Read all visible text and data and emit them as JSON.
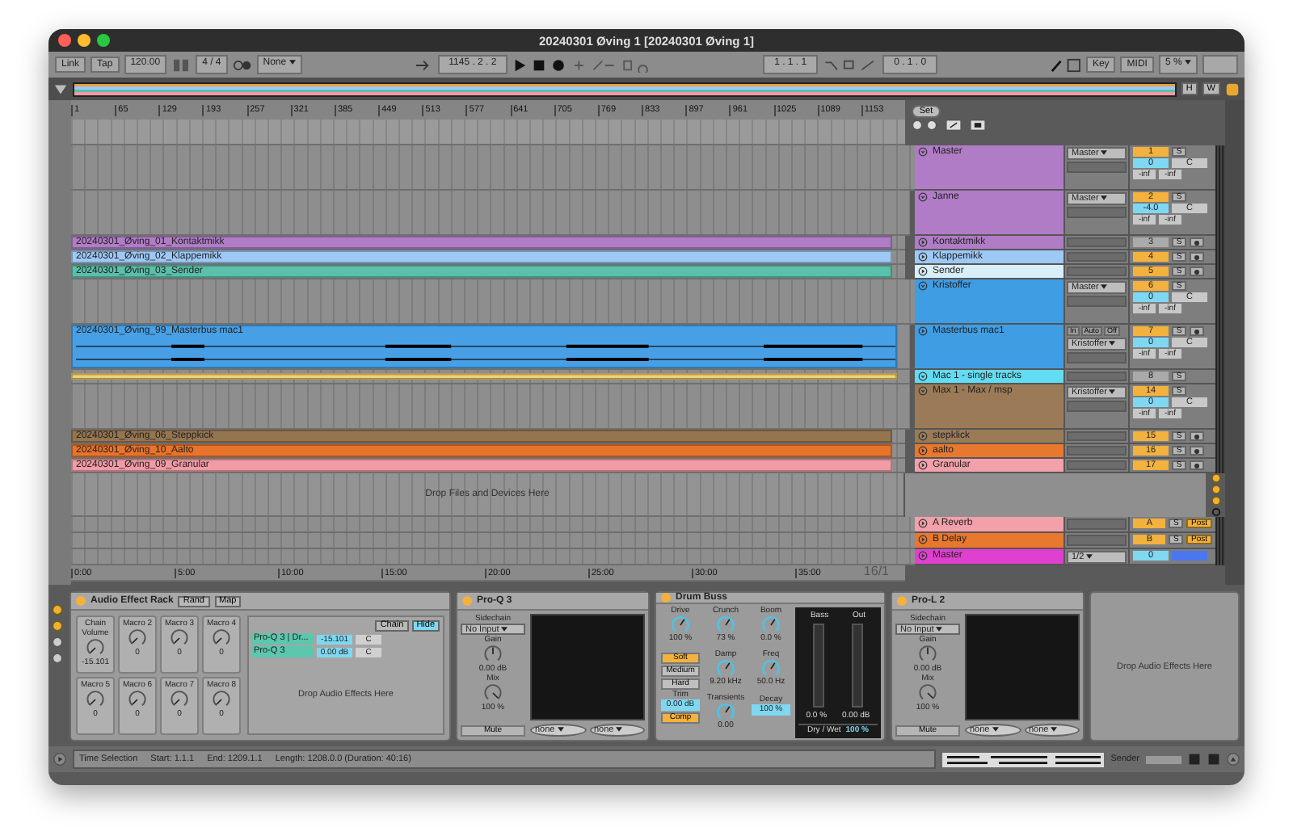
{
  "window": {
    "title": "20240301 Øving 1  [20240301 Øving 1]"
  },
  "toolbar": {
    "link": "Link",
    "tap": "Tap",
    "tempo": "120.00",
    "signature": "4 / 4",
    "quantize": "None",
    "position": "1145 .  2 .  2",
    "loop_start": "1 .  1 .  1",
    "loop_length": "0 .  1 .  0",
    "key": "Key",
    "midi": "MIDI",
    "zoom": "5 %"
  },
  "overview": {
    "buttons": [
      "H",
      "W"
    ]
  },
  "set_button": "Set",
  "ruler": {
    "bars": [
      "1",
      "65",
      "129",
      "193",
      "257",
      "321",
      "385",
      "449",
      "513",
      "577",
      "641",
      "705",
      "769",
      "833",
      "897",
      "961",
      "1025",
      "1089",
      "1153"
    ]
  },
  "tracks": [
    {
      "name": "Master",
      "kind": "group",
      "color": "#b07cc6",
      "expanded": true,
      "active": true,
      "number": "1",
      "solo": "S",
      "output": "Master",
      "volume": "0",
      "pan": "C",
      "peaks": [
        "-inf",
        "-inf"
      ],
      "children": [
        {
          "name": "Janne",
          "kind": "group",
          "color": "#b07cc6",
          "expanded": true,
          "active": true,
          "number": "2",
          "solo": "S",
          "output": "Master",
          "volume": "-4.0",
          "pan": "C",
          "peaks": [
            "-inf",
            "-inf"
          ],
          "children": [
            {
              "name": "Kontaktmikk",
              "kind": "audio",
              "color": "#b07cc6",
              "expanded": false,
              "active": false,
              "number": "3",
              "solo": "S",
              "clip": {
                "name": "20240301_Øving_01_Kontaktmikk",
                "color": "#b07cc6"
              }
            },
            {
              "name": "Klappemikk",
              "kind": "audio",
              "color": "#9ec8f6",
              "expanded": false,
              "active": true,
              "number": "4",
              "solo": "S",
              "clip": {
                "name": "20240301_Øving_02_Klappemikk",
                "color": "#9ec8f6"
              }
            },
            {
              "name": "Sender",
              "kind": "audio",
              "color": "#d8eef8",
              "expanded": false,
              "active": true,
              "number": "5",
              "solo": "S",
              "clip": {
                "name": "20240301_Øving_03_Sender",
                "color": "#5bbfa9"
              }
            }
          ]
        }
      ]
    },
    {
      "name": "Kristoffer",
      "kind": "group",
      "color": "#3f9de3",
      "expanded": true,
      "active": true,
      "number": "6",
      "solo": "S",
      "output": "Master",
      "volume": "0",
      "pan": "C",
      "peaks": [
        "-inf",
        "-inf"
      ],
      "children": [
        {
          "name": "Masterbus mac1",
          "kind": "audio",
          "color": "#3f9de3",
          "expanded": true,
          "active": true,
          "number": "7",
          "solo": "S",
          "monitor": [
            {
              "label": "In",
              "selected": false
            },
            {
              "label": "Auto",
              "selected": false
            },
            {
              "label": "Off",
              "selected": false
            }
          ],
          "output": "Kristoffer",
          "volume": "0",
          "pan": "C",
          "peaks": [
            "-inf",
            "-inf"
          ],
          "clip": {
            "name": "20240301_Øving_99_Masterbus mac1",
            "color": "#47a0e6",
            "waveform": true
          }
        },
        {
          "name": "Mac 1 - single tracks",
          "kind": "group",
          "color": "#62dcf2",
          "expanded": false,
          "active": false,
          "number": "8",
          "solo": "S",
          "clip": {
            "color": "#e8d47c"
          }
        },
        {
          "name": "Max 1 - Max / msp",
          "kind": "group",
          "color": "#9b7b57",
          "expanded": true,
          "active": true,
          "number": "14",
          "solo": "S",
          "output": "Kristoffer",
          "volume": "0",
          "pan": "C",
          "peaks": [
            "-inf",
            "-inf"
          ],
          "children": [
            {
              "name": "stepklick",
              "kind": "audio",
              "color": "#9b7b57",
              "expanded": false,
              "active": true,
              "number": "15",
              "solo": "S",
              "clip": {
                "name": "20240301_Øving_06_Steppkick",
                "color": "#957550"
              }
            },
            {
              "name": "aalto",
              "kind": "audio",
              "color": "#e8782e",
              "expanded": false,
              "active": true,
              "number": "16",
              "solo": "S",
              "clip": {
                "name": "20240301_Øving_10_Aalto",
                "color": "#e8732a"
              }
            },
            {
              "name": "Granular",
              "kind": "audio",
              "color": "#f2a0aa",
              "expanded": false,
              "active": true,
              "number": "17",
              "solo": "S",
              "clip": {
                "name": "20240301_Øving_09_Granular",
                "color": "#f19ba5"
              }
            }
          ]
        }
      ]
    }
  ],
  "drop_hint": "Drop Files and Devices Here",
  "returns": [
    {
      "name": "A Reverb",
      "color": "#f2a0aa",
      "number": "A",
      "solo": "S",
      "send_mode": "Post"
    },
    {
      "name": "B Delay",
      "color": "#e8782e",
      "number": "B",
      "solo": "S",
      "send_mode": "Post"
    }
  ],
  "master": {
    "name": "Master",
    "color": "#e040d0",
    "output": "1/2",
    "volume": "0"
  },
  "time_ruler": {
    "labels": [
      "0:00",
      "5:00",
      "10:00",
      "15:00",
      "20:00",
      "25:00",
      "30:00",
      "35:00"
    ],
    "zoom_label": "16/1"
  },
  "devices": [
    {
      "kind": "rack",
      "title": "Audio Effect Rack",
      "on": true,
      "buttons": [
        "Rand",
        "Map"
      ],
      "macros": [
        {
          "label": "Chain Volume",
          "value": "-15.101"
        },
        {
          "label": "Macro 2",
          "value": "0"
        },
        {
          "label": "Macro 3",
          "value": "0"
        },
        {
          "label": "Macro 4",
          "value": "0"
        },
        {
          "label": "Macro 5",
          "value": "0"
        },
        {
          "label": "Macro 6",
          "value": "0"
        },
        {
          "label": "Macro 7",
          "value": "0"
        },
        {
          "label": "Macro 8",
          "value": "0"
        }
      ],
      "chain_buttons": [
        {
          "label": "Chain",
          "selected": false
        },
        {
          "label": "Hide",
          "selected": true
        }
      ],
      "chains": [
        {
          "name": "Pro-Q 3 | Dr...",
          "volume": "-15.101",
          "pan": "C"
        },
        {
          "name": "Pro-Q 3",
          "volume": "0.00 dB",
          "pan": "C"
        }
      ],
      "drop_hint": "Drop Audio Effects Here"
    },
    {
      "kind": "plugin",
      "title": "Pro-Q 3",
      "on": true,
      "sidechain_label": "Sidechain",
      "sidechain": "No Input",
      "gain_label": "Gain",
      "gain": "0.00 dB",
      "mix_label": "Mix",
      "mix": "100 %",
      "mute": "Mute",
      "menus": [
        "none",
        "none"
      ]
    },
    {
      "kind": "drumbuss",
      "title": "Drum Buss",
      "on": true,
      "columns": [
        [
          {
            "kind": "knob",
            "label": "Drive",
            "value": "100 %"
          },
          {
            "kind": "modes",
            "options": [
              {
                "label": "Soft",
                "selected": true
              },
              {
                "label": "Medium",
                "selected": false
              },
              {
                "label": "Hard",
                "selected": false
              }
            ]
          },
          {
            "kind": "box",
            "label": "Trim",
            "value": "0.00 dB"
          },
          {
            "kind": "toggle",
            "label": "Comp",
            "on": true
          }
        ],
        [
          {
            "kind": "knob",
            "label": "Crunch",
            "value": "73 %"
          },
          {
            "kind": "knob",
            "label": "Damp",
            "value": "9.20 kHz"
          },
          {
            "kind": "knob",
            "label": "Transients",
            "value": "0.00"
          }
        ],
        [
          {
            "kind": "knob",
            "label": "Boom",
            "value": "0.0 %"
          },
          {
            "kind": "knob",
            "label": "Freq",
            "value": "50.0 Hz"
          },
          {
            "kind": "box",
            "label": "Decay",
            "value": "100 %"
          }
        ]
      ],
      "meter_labels": [
        "Bass",
        "Out"
      ],
      "meter_values": [
        "0.0 %",
        "0.00 dB"
      ],
      "drywet_label": "Dry / Wet",
      "drywet": "100 %"
    },
    {
      "kind": "plugin",
      "title": "Pro-L 2",
      "on": true,
      "sidechain_label": "Sidechain",
      "sidechain": "No Input",
      "gain_label": "Gain",
      "gain": "0.00 dB",
      "mix_label": "Mix",
      "mix": "100 %",
      "mute": "Mute",
      "menus": [
        "none",
        "none"
      ]
    },
    {
      "kind": "drop",
      "text": "Drop Audio Effects Here"
    }
  ],
  "status_bar": {
    "texts": [
      "Time Selection",
      "Start: 1.1.1",
      "End: 1209.1.1",
      "Length: 1208.0.0  (Duration: 40:16)"
    ],
    "track_label": "Sender"
  }
}
